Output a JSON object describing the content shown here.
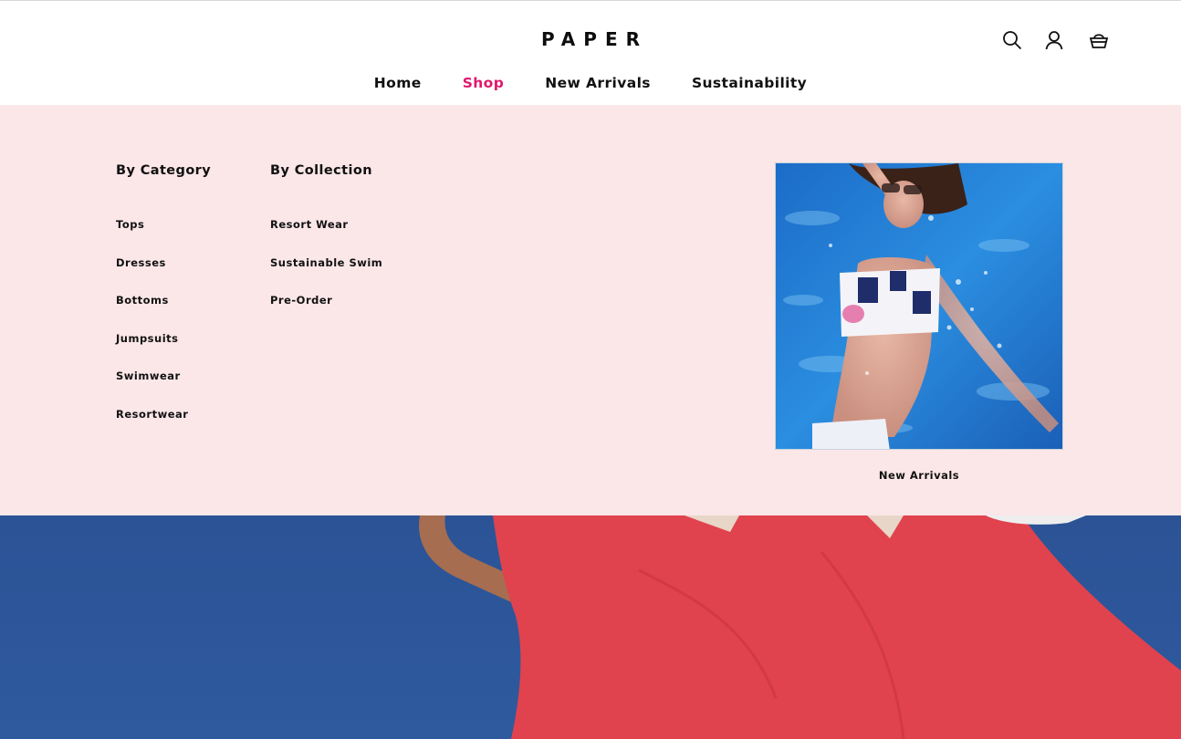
{
  "brand": {
    "logo": "PAPER"
  },
  "header": {
    "icons": [
      "search-icon",
      "account-icon",
      "basket-icon"
    ]
  },
  "nav": {
    "items": [
      {
        "label": "Home"
      },
      {
        "label": "Shop",
        "active": true
      },
      {
        "label": "New Arrivals"
      },
      {
        "label": "Sustainability"
      }
    ]
  },
  "menu": {
    "category": {
      "title": "By Category",
      "links": [
        "Tops",
        "Dresses",
        "Bottoms",
        "Jumpsuits",
        "Swimwear",
        "Resortwear"
      ]
    },
    "collection": {
      "title": "By Collection",
      "links": [
        "Resort Wear",
        "Sustainable Swim",
        "Pre-Order"
      ]
    },
    "promo": {
      "caption": "New Arrivals"
    }
  },
  "colors": {
    "accent": "#e0196f",
    "menu_bg": "#fbe6e8",
    "hero_sky": "#2e5595",
    "hero_dress": "#e0434e"
  }
}
